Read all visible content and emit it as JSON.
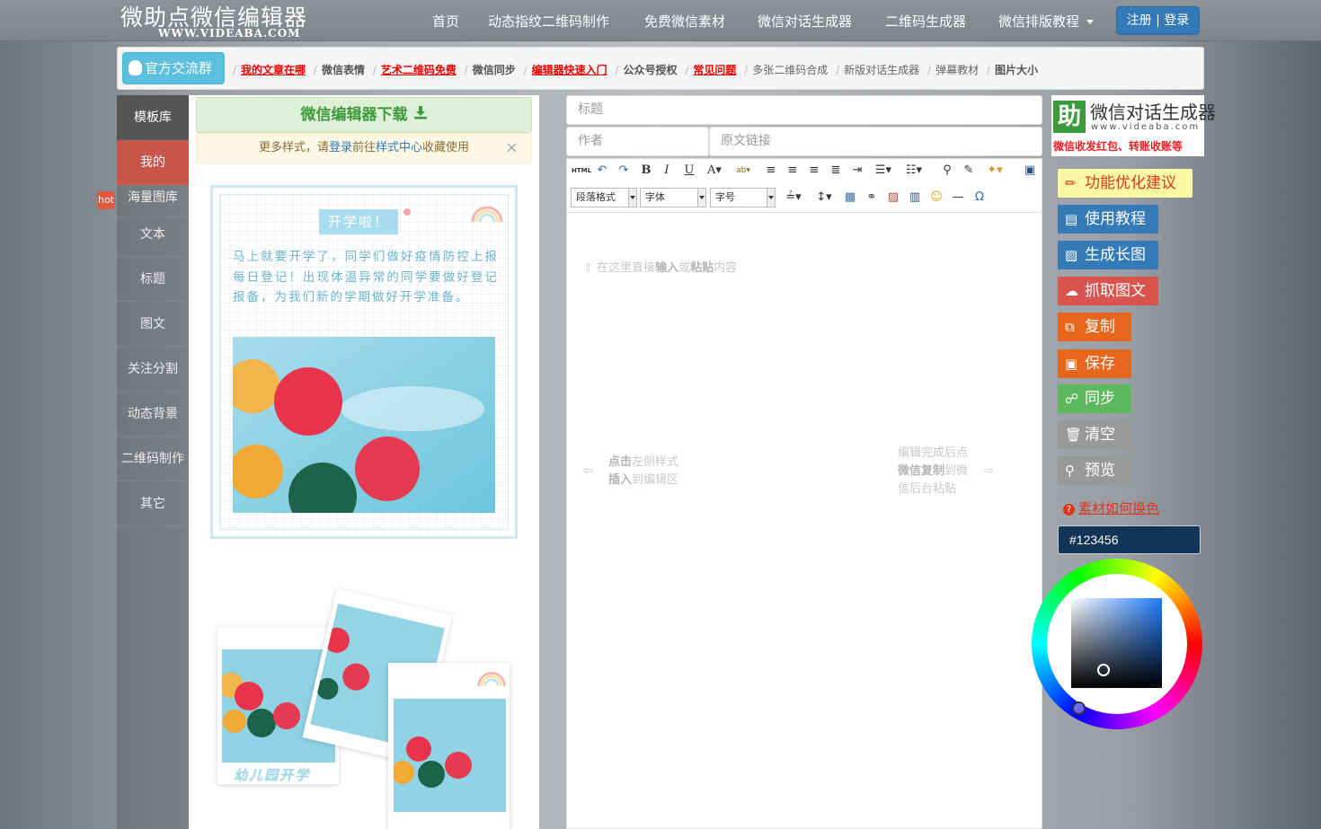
{
  "header": {
    "logo_main": "微助点微信编辑器",
    "logo_sub": "WWW.VIDEABA.COM",
    "nav": [
      "首页",
      "动态指纹二维码制作",
      "免费微信素材",
      "微信对话生成器",
      "二维码生成器",
      "微信排版教程"
    ],
    "login": "注册 | 登录"
  },
  "linkbar": {
    "group_button": "官方交流群",
    "links": [
      "我的文章在哪",
      "微信表情",
      "艺术二维码免费",
      "微信同步",
      "编辑器快速入门",
      "公众号授权",
      "常见问题",
      "多张二维码合成",
      "新版对话生成器",
      "弹幕教材",
      "图片大小"
    ]
  },
  "sidebar": {
    "items": [
      "模板库",
      "我的",
      "海量图库",
      "文本",
      "标题",
      "图文",
      "关注分割",
      "动态背景",
      "二维码制作",
      "其它"
    ],
    "hot_badge": "hot"
  },
  "stylepanel": {
    "download": "微信编辑器下载",
    "notice_pre": "更多样式，请",
    "notice_login": "登录",
    "notice_mid": "前往",
    "notice_center": "样式中心",
    "notice_post": "收藏使用",
    "notice_close": "×",
    "card_tag": "开学啦！",
    "card_text": "马上就要开学了，同学们做好疫情防控上报每日登记！出现体温异常的同学要做好登记报备，为我们新的学期做好开学准备。",
    "polaroid_caption": "幼儿园开学"
  },
  "editor": {
    "title_placeholder": "标题",
    "author_placeholder": "作者",
    "link_placeholder": "原文链接",
    "toolbar": {
      "paragraph": "段落格式",
      "font": "字体",
      "size": "字号"
    },
    "hint_top_pre": "在这里直接",
    "hint_top_b1": "输入",
    "hint_top_mid": "或",
    "hint_top_b2": "粘贴",
    "hint_top_post": "内容",
    "hint_left_b1": "点击",
    "hint_left_1": "左侧样式",
    "hint_left_b2": "插入",
    "hint_left_2": "到编辑区",
    "hint_right_1": "编辑完成后点",
    "hint_right_b1": "微信复制",
    "hint_right_2": "到微",
    "hint_right_3": "信后台粘贴"
  },
  "rightpanel": {
    "banner_title": "微信对话生成器",
    "banner_url": "www.videaba.com",
    "banner_slogan": "微信收发红包、转账收账等",
    "buttons": [
      "功能优化建议",
      "使用教程",
      "生成长图",
      "抓取图文",
      "复制",
      "保存",
      "同步",
      "清空",
      "预览"
    ],
    "howto": "素材如何换色",
    "color_value": "#123456"
  },
  "colors": {
    "primary": "#337ab7",
    "info": "#5bc0de",
    "danger": "#d9534f",
    "warning": "#e8651c",
    "success": "#5cb85c",
    "default": "#909090",
    "accent_red": "#c8544a"
  }
}
